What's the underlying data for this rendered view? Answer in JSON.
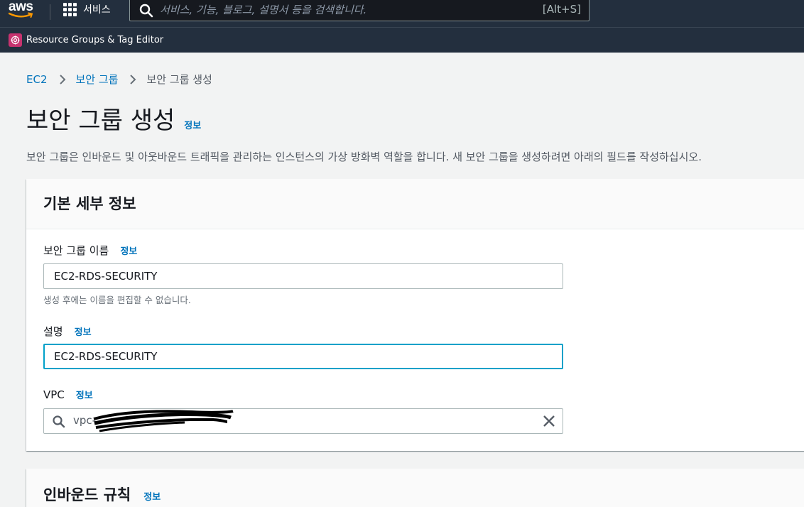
{
  "topnav": {
    "logo_text": "aws",
    "services_label": "서비스",
    "search_placeholder": "서비스, 기능, 블로그, 설명서 등을 검색합니다.",
    "search_shortcut": "[Alt+S]"
  },
  "subnav": {
    "resource_groups_label": "Resource Groups & Tag Editor"
  },
  "breadcrumb": [
    "EC2",
    "보안 그룹",
    "보안 그룹 생성"
  ],
  "page": {
    "title": "보안 그룹 생성",
    "info_label": "정보",
    "description": "보안 그룹은 인바운드 및 아웃바운드 트래픽을 관리하는 인스턴스의 가상 방화벽 역할을 합니다. 새 보안 그룹을 생성하려면 아래의 필드를 작성하십시오."
  },
  "basic_details": {
    "heading": "기본 세부 정보",
    "name_label": "보안 그룹 이름",
    "name_value": "EC2-RDS-SECURITY",
    "name_hint": "생성 후에는 이름을 편집할 수 없습니다.",
    "description_label": "설명",
    "description_value": "EC2-RDS-SECURITY",
    "vpc_label": "VPC",
    "vpc_value": "vpc-",
    "info_label": "정보"
  },
  "inbound": {
    "heading": "인바운드 규칙",
    "info_label": "정보"
  },
  "colors": {
    "nav_bg": "#232f3e",
    "link": "#0073bb",
    "focus": "#00a1c9",
    "rg_icon": "#c7336f"
  }
}
